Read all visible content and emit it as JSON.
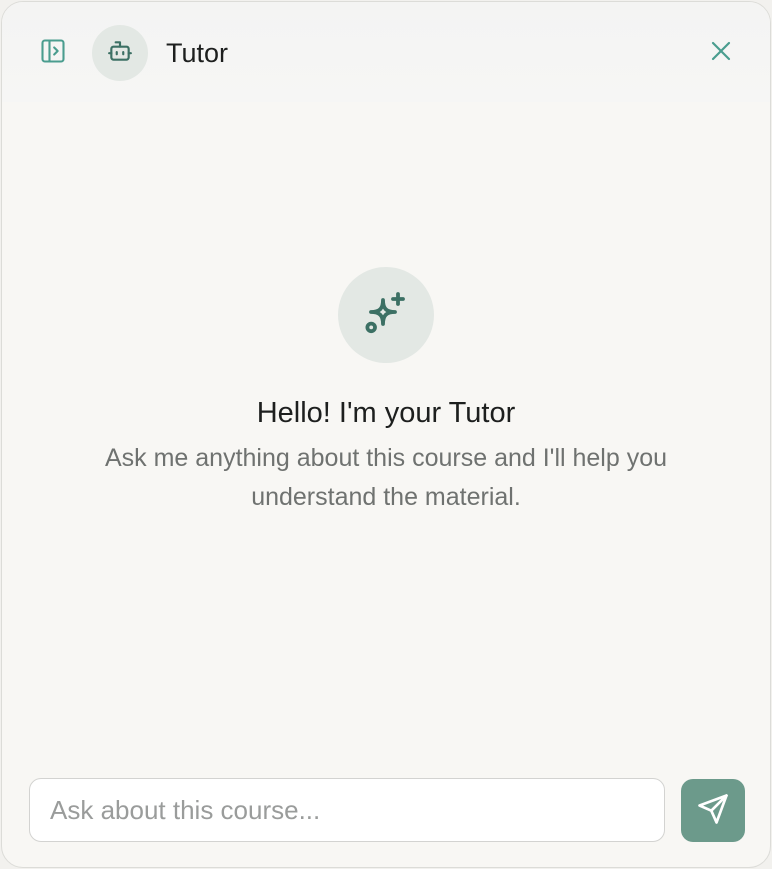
{
  "header": {
    "title": "Tutor",
    "sidebar_toggle_icon": "panel-toggle-icon",
    "avatar_icon": "bot-icon",
    "close_icon": "close-icon"
  },
  "welcome": {
    "icon": "sparkles-icon",
    "title": "Hello! I'm your Tutor",
    "subtitle": "Ask me anything about this course and I'll help you understand the material."
  },
  "composer": {
    "value": "",
    "placeholder": "Ask about this course...",
    "send_icon": "send-icon"
  },
  "colors": {
    "accent": "#4a9d8f",
    "icon_dark": "#3c7064",
    "send_button": "#6c9a8b",
    "avatar_bg": "#e3e8e4"
  }
}
